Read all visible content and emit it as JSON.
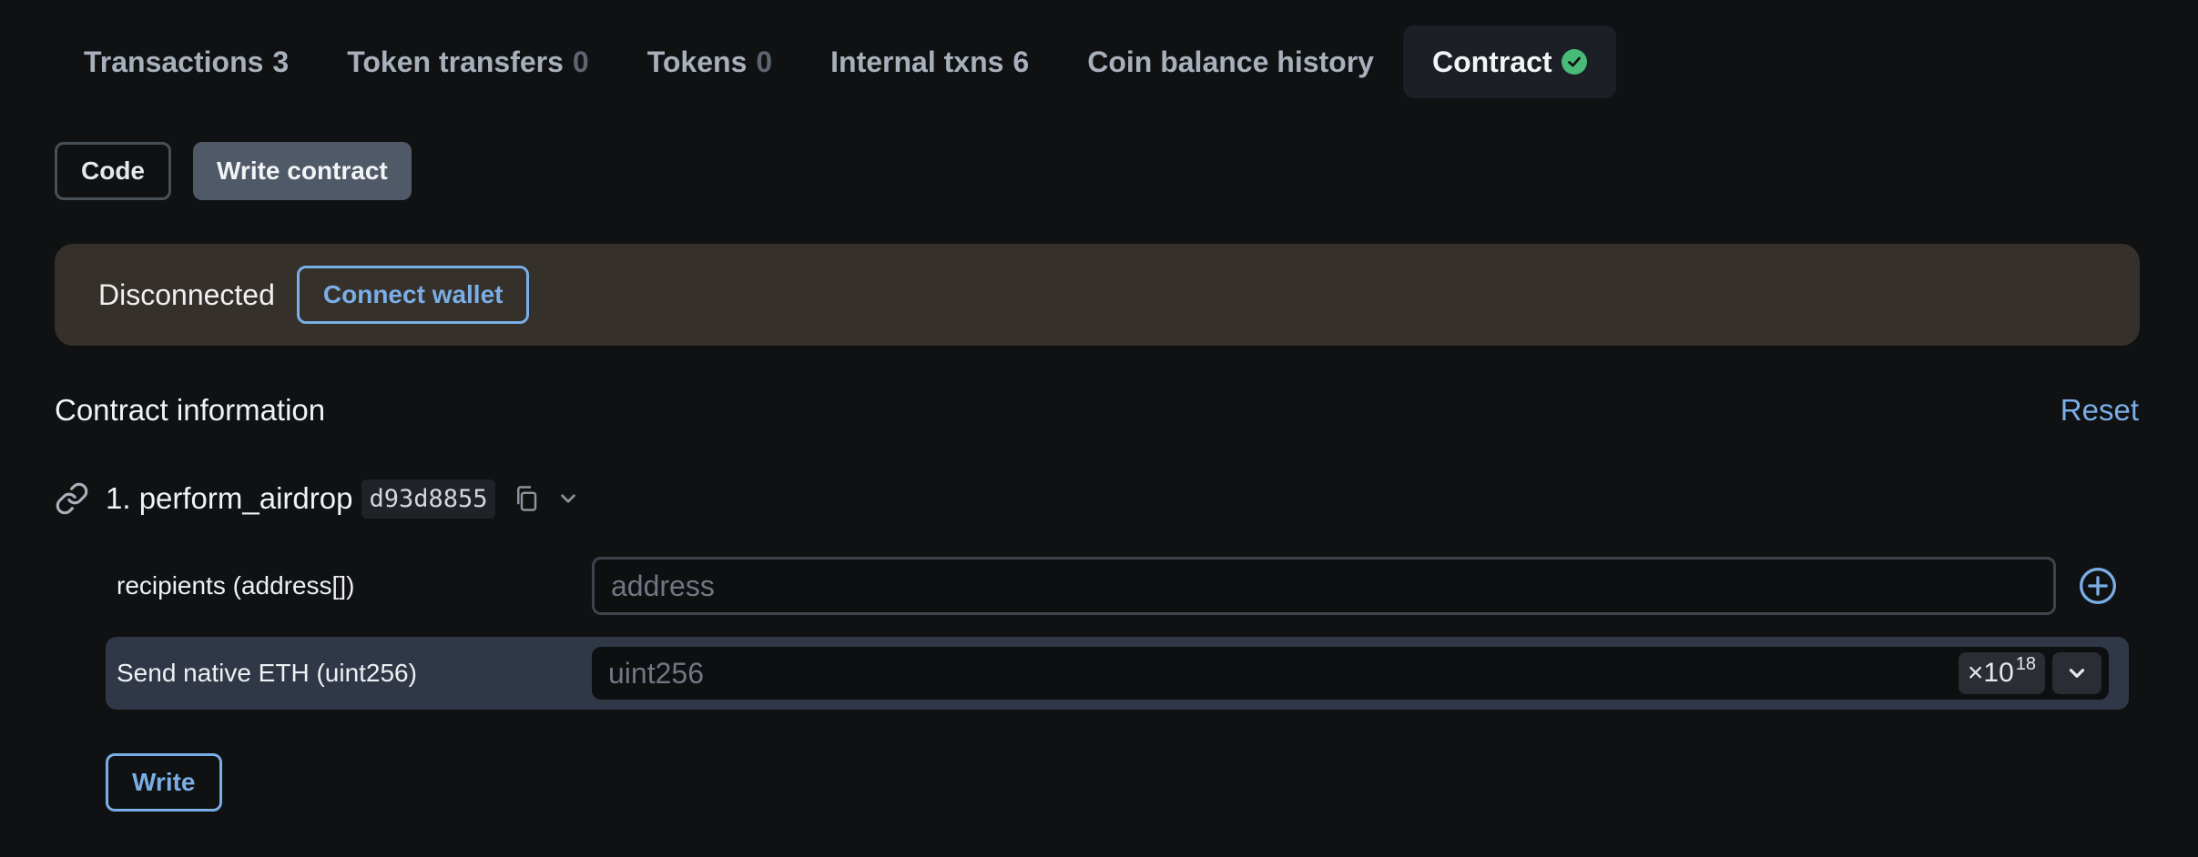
{
  "tabs": [
    {
      "label": "Transactions",
      "count": "3"
    },
    {
      "label": "Token transfers",
      "count": "0"
    },
    {
      "label": "Tokens",
      "count": "0"
    },
    {
      "label": "Internal txns",
      "count": "6"
    },
    {
      "label": "Coin balance history",
      "count": ""
    },
    {
      "label": "Contract",
      "count": ""
    }
  ],
  "subtabs": {
    "code": "Code",
    "write_contract": "Write contract"
  },
  "alert": {
    "status": "Disconnected",
    "connect_label": "Connect wallet"
  },
  "contract_info": {
    "title": "Contract information",
    "reset_label": "Reset"
  },
  "method": {
    "name": "1. perform_airdrop",
    "signature": "d93d8855",
    "fields": {
      "recipients_label": "recipients (address[])",
      "recipients_placeholder": "address",
      "eth_label": "Send native ETH (uint256)",
      "eth_placeholder": "uint256",
      "multiplier_base": "×10",
      "multiplier_exp": "18"
    },
    "write_label": "Write"
  },
  "colors": {
    "background": "#101112",
    "accent_blue": "#7aaee6",
    "verified_green": "#48bb78",
    "alert_bg": "#35302a"
  },
  "icons": [
    "check-circle-icon",
    "link-icon",
    "copy-icon",
    "chevron-down-icon",
    "plus-circle-icon"
  ]
}
